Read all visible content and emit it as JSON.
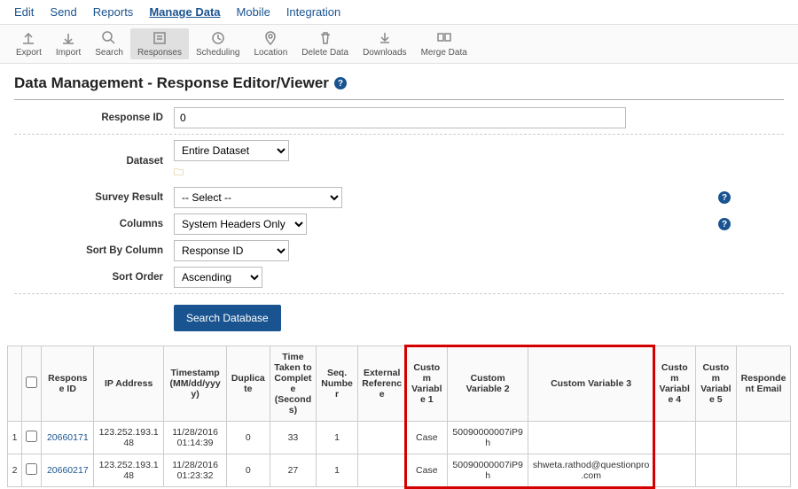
{
  "nav": {
    "edit": "Edit",
    "send": "Send",
    "reports": "Reports",
    "manage": "Manage Data",
    "mobile": "Mobile",
    "integration": "Integration"
  },
  "toolbar": {
    "export": "Export",
    "import": "Import",
    "search": "Search",
    "responses": "Responses",
    "scheduling": "Scheduling",
    "location": "Location",
    "delete": "Delete Data",
    "downloads": "Downloads",
    "merge": "Merge Data"
  },
  "page": {
    "title": "Data Management - Response Editor/Viewer"
  },
  "form": {
    "response_id_label": "Response ID",
    "response_id_value": "0",
    "dataset_label": "Dataset",
    "dataset_value": "Entire Dataset",
    "survey_result_label": "Survey Result",
    "survey_result_value": "-- Select --",
    "columns_label": "Columns",
    "columns_value": "System Headers Only",
    "sort_by_label": "Sort By Column",
    "sort_by_value": "Response ID",
    "sort_order_label": "Sort Order",
    "sort_order_value": "Ascending",
    "search_btn": "Search Database"
  },
  "table": {
    "headers": {
      "response_id": "Response ID",
      "ip": "IP Address",
      "timestamp": "Timestamp (MM/dd/yyyy)",
      "duplicate": "Duplicate",
      "time_taken": "Time Taken to Complete (Seconds)",
      "seq": "Seq. Number",
      "ext_ref": "External Reference",
      "cv1": "Custom Variable 1",
      "cv2": "Custom Variable 2",
      "cv3": "Custom Variable 3",
      "cv4": "Custom Variable 4",
      "cv5": "Custom Variable 5",
      "email": "Respondent Email"
    },
    "rows": [
      {
        "n": "1",
        "id": "20660171",
        "ip": "123.252.193.148",
        "ts": "11/28/2016 01:14:39",
        "dup": "0",
        "time": "33",
        "seq": "1",
        "ext": "",
        "cv1": "Case",
        "cv2": "50090000007iP9h",
        "cv3": "",
        "cv4": "",
        "cv5": "",
        "email": ""
      },
      {
        "n": "2",
        "id": "20660217",
        "ip": "123.252.193.148",
        "ts": "11/28/2016 01:23:32",
        "dup": "0",
        "time": "27",
        "seq": "1",
        "ext": "",
        "cv1": "Case",
        "cv2": "50090000007iP9h",
        "cv3": "shweta.rathod@questionpro.com",
        "cv4": "",
        "cv5": "",
        "email": ""
      }
    ]
  }
}
